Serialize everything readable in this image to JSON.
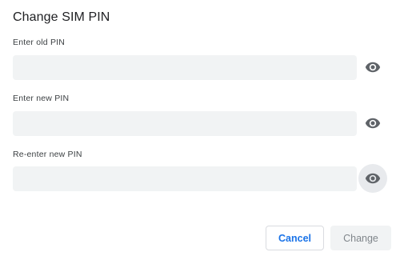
{
  "dialog": {
    "title": "Change SIM PIN",
    "fields": [
      {
        "label": "Enter old PIN",
        "value": "",
        "placeholder": "",
        "toggle_icon": "eye-icon"
      },
      {
        "label": "Enter new PIN",
        "value": "",
        "placeholder": "",
        "toggle_icon": "eye-icon"
      },
      {
        "label": "Re-enter new PIN",
        "value": "",
        "placeholder": "",
        "toggle_icon": "eye-icon"
      }
    ],
    "buttons": {
      "cancel_label": "Cancel",
      "change_label": "Change"
    }
  },
  "colors": {
    "accent": "#1a73e8",
    "input_background": "#f1f3f4",
    "icon": "#5f6368",
    "disabled_text": "#80868b"
  }
}
